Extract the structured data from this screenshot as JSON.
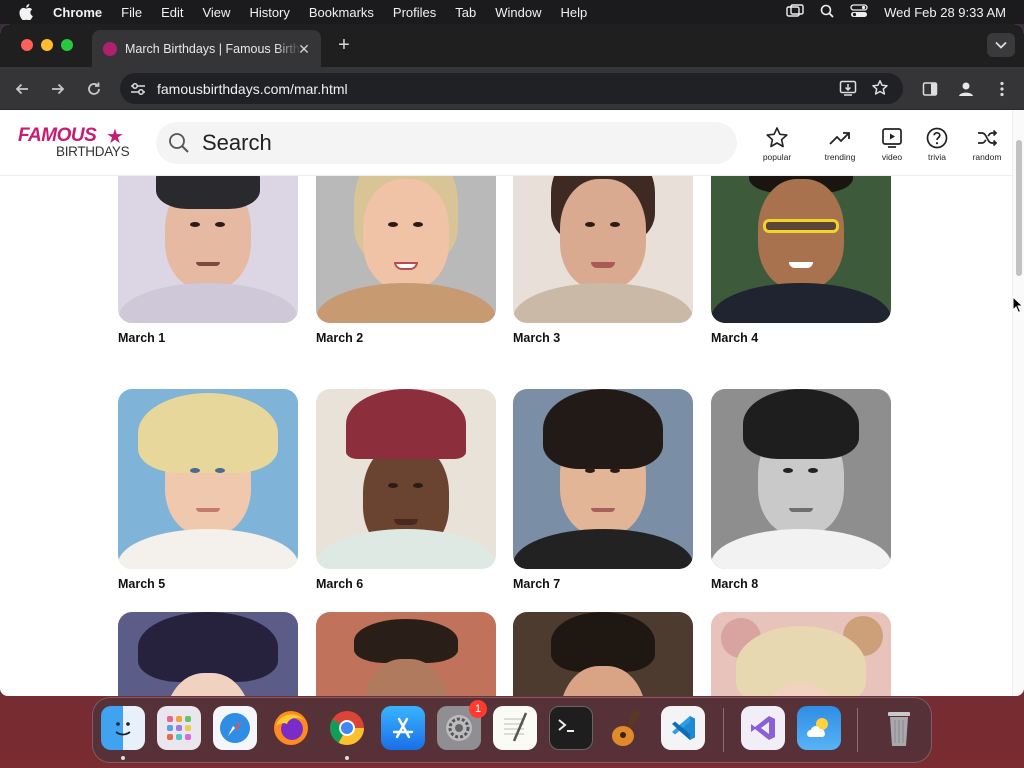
{
  "menubar": {
    "app": "Chrome",
    "items": [
      "File",
      "Edit",
      "View",
      "History",
      "Bookmarks",
      "Profiles",
      "Tab",
      "Window",
      "Help"
    ],
    "clock": "Wed Feb 28  9:33 AM"
  },
  "browser": {
    "tab_title": "March Birthdays | Famous Birthdays",
    "url": "famousbirthdays.com/mar.html"
  },
  "site": {
    "logo_top": "FAMOUS",
    "logo_bottom": "BIRTHDAYS",
    "search_placeholder": "Search",
    "nav": [
      {
        "label": "popular",
        "icon": "star-icon"
      },
      {
        "label": "trending",
        "icon": "trending-icon"
      },
      {
        "label": "video",
        "icon": "video-icon"
      },
      {
        "label": "trivia",
        "icon": "question-icon"
      },
      {
        "label": "random",
        "icon": "shuffle-icon"
      }
    ]
  },
  "days": [
    {
      "label": "March 1"
    },
    {
      "label": "March 2"
    },
    {
      "label": "March 3"
    },
    {
      "label": "March 4"
    },
    {
      "label": "March 5"
    },
    {
      "label": "March 6"
    },
    {
      "label": "March 7"
    },
    {
      "label": "March 8"
    },
    {
      "label": ""
    },
    {
      "label": ""
    },
    {
      "label": ""
    },
    {
      "label": ""
    }
  ],
  "dock": {
    "apps": [
      "finder-icon",
      "launchpad-icon",
      "safari-icon",
      "firefox-icon",
      "chrome-icon",
      "app-store-icon",
      "system-settings-icon",
      "textedit-icon",
      "terminal-icon",
      "garageband-icon",
      "vscode-icon",
      "visual-studio-icon",
      "weather-icon",
      "trash-icon"
    ],
    "settings_badge": "1"
  }
}
